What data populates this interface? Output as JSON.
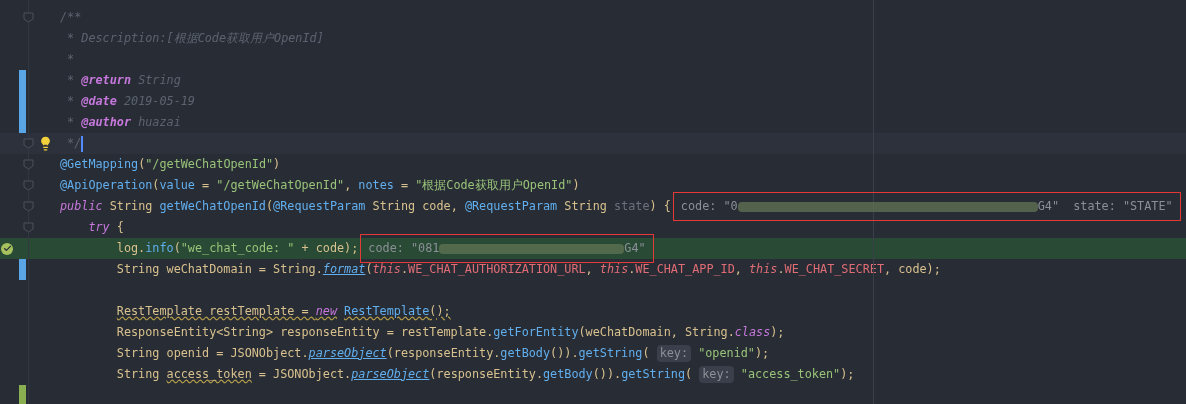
{
  "editor": {
    "lines": [
      {
        "fold": true,
        "modified": false,
        "added": false,
        "current": false,
        "execution": false,
        "tokens": [
          {
            "kind": "comment",
            "text": "/**"
          }
        ]
      },
      {
        "fold": false,
        "modified": false,
        "added": false,
        "current": false,
        "execution": false,
        "tokens": [
          {
            "kind": "comment",
            "text": " * Description:[根据Code获取用户OpenId]"
          }
        ]
      },
      {
        "fold": false,
        "modified": false,
        "added": false,
        "current": false,
        "execution": false,
        "tokens": [
          {
            "kind": "comment",
            "text": " *"
          }
        ]
      },
      {
        "fold": false,
        "modified": true,
        "added": false,
        "current": false,
        "execution": false,
        "tokens": [
          {
            "kind": "comment",
            "text": " * "
          },
          {
            "kind": "doctag",
            "text": "@return"
          },
          {
            "kind": "comment",
            "text": " String"
          }
        ]
      },
      {
        "fold": false,
        "modified": true,
        "added": false,
        "current": false,
        "execution": false,
        "tokens": [
          {
            "kind": "comment",
            "text": " * "
          },
          {
            "kind": "doctag",
            "text": "@date"
          },
          {
            "kind": "comment",
            "text": " 2019-05-19"
          }
        ]
      },
      {
        "fold": false,
        "modified": true,
        "added": false,
        "current": false,
        "execution": false,
        "tokens": [
          {
            "kind": "comment",
            "text": " * "
          },
          {
            "kind": "doctag",
            "text": "@author"
          },
          {
            "kind": "comment",
            "text": " huazai"
          }
        ]
      },
      {
        "fold": true,
        "modified": false,
        "added": false,
        "current": true,
        "execution": false,
        "tokens": [
          {
            "kind": "comment",
            "text": " */"
          }
        ]
      },
      {
        "fold": true,
        "modified": false,
        "added": false,
        "current": false,
        "execution": false,
        "tokens": [
          {
            "kind": "annotation",
            "text": "@GetMapping"
          },
          {
            "kind": "plain",
            "text": "("
          },
          {
            "kind": "string",
            "text": "\"/getWeChatOpenId\""
          },
          {
            "kind": "plain",
            "text": ")"
          }
        ]
      },
      {
        "fold": true,
        "modified": false,
        "added": false,
        "current": false,
        "execution": false,
        "tokens": [
          {
            "kind": "annotation",
            "text": "@ApiOperation"
          },
          {
            "kind": "plain",
            "text": "("
          },
          {
            "kind": "annotation",
            "text": "value"
          },
          {
            "kind": "plain",
            "text": " = "
          },
          {
            "kind": "string",
            "text": "\"/getWeChatOpenId\""
          },
          {
            "kind": "plain",
            "text": ", "
          },
          {
            "kind": "annotation",
            "text": "notes"
          },
          {
            "kind": "plain",
            "text": " = "
          },
          {
            "kind": "string",
            "text": "\"根据Code获取用户OpenId\""
          },
          {
            "kind": "plain",
            "text": ")"
          }
        ]
      },
      {
        "fold": true,
        "modified": false,
        "added": false,
        "current": false,
        "execution": false,
        "tokens": [
          {
            "kind": "keyword",
            "text": "public"
          },
          {
            "kind": "plain",
            "text": " String "
          },
          {
            "kind": "method",
            "text": "getWeChatOpenId"
          },
          {
            "kind": "plain",
            "text": "("
          },
          {
            "kind": "annotation",
            "text": "@RequestParam"
          },
          {
            "kind": "plain",
            "text": " String code, "
          },
          {
            "kind": "annotation",
            "text": "@RequestParam"
          },
          {
            "kind": "plain",
            "text": " String "
          },
          {
            "kind": "unused",
            "text": "state"
          },
          {
            "kind": "plain",
            "text": ") {"
          }
        ],
        "hint": {
          "boxed": true,
          "parts": [
            {
              "kind": "hint",
              "text": "code: \"0"
            },
            {
              "kind": "redacted"
            },
            {
              "kind": "hint",
              "text": "G4\"  state: \"STATE\""
            }
          ]
        }
      },
      {
        "fold": true,
        "modified": false,
        "added": false,
        "current": false,
        "execution": false,
        "tokens": [
          {
            "kind": "keyword",
            "text": "    try"
          },
          {
            "kind": "plain",
            "text": " {"
          }
        ]
      },
      {
        "fold": false,
        "modified": false,
        "added": false,
        "current": false,
        "execution": true,
        "tokens": [
          {
            "kind": "plain",
            "text": "        log."
          },
          {
            "kind": "method",
            "text": "info"
          },
          {
            "kind": "plain",
            "text": "("
          },
          {
            "kind": "string",
            "text": "\"we_chat_code: \""
          },
          {
            "kind": "plain",
            "text": " + code);"
          }
        ],
        "hint": {
          "boxed": true,
          "parts": [
            {
              "kind": "hint",
              "text": "code: \"081"
            },
            {
              "kind": "redacted"
            },
            {
              "kind": "hint",
              "text": "G4\""
            }
          ]
        }
      },
      {
        "fold": false,
        "modified": true,
        "added": false,
        "current": false,
        "execution": false,
        "tokens": [
          {
            "kind": "plain",
            "text": "        String weChatDomain = String."
          },
          {
            "kind": "static",
            "text": "format"
          },
          {
            "kind": "plain",
            "text": "("
          },
          {
            "kind": "this",
            "text": "this"
          },
          {
            "kind": "plain",
            "text": "."
          },
          {
            "kind": "constant",
            "text": "WE_CHAT_AUTHORIZATION_URL"
          },
          {
            "kind": "plain",
            "text": ", "
          },
          {
            "kind": "this",
            "text": "this"
          },
          {
            "kind": "plain",
            "text": "."
          },
          {
            "kind": "constant",
            "text": "WE_CHAT_APP_ID"
          },
          {
            "kind": "plain",
            "text": ", "
          },
          {
            "kind": "this",
            "text": "this"
          },
          {
            "kind": "plain",
            "text": "."
          },
          {
            "kind": "constant",
            "text": "WE_CHAT_SECRET"
          },
          {
            "kind": "plain",
            "text": ", code);"
          }
        ]
      },
      {
        "fold": false,
        "modified": false,
        "added": false,
        "current": false,
        "execution": false
      },
      {
        "fold": false,
        "modified": false,
        "added": false,
        "current": false,
        "execution": false,
        "tokens": [
          {
            "kind": "warning",
            "text": "        RestTemplate restTemplate = "
          },
          {
            "kind": "keyword_warning",
            "text": "new"
          },
          {
            "kind": "method_warning",
            "text": " RestTemplate"
          },
          {
            "kind": "warning",
            "text": "();"
          }
        ]
      },
      {
        "fold": false,
        "modified": false,
        "added": false,
        "current": false,
        "execution": false,
        "tokens": [
          {
            "kind": "plain",
            "text": "        ResponseEntity<String> responseEntity = restTemplate."
          },
          {
            "kind": "method",
            "text": "getForEntity"
          },
          {
            "kind": "plain",
            "text": "(weChatDomain, String."
          },
          {
            "kind": "keyword",
            "text": "class"
          },
          {
            "kind": "plain",
            "text": ");"
          }
        ]
      },
      {
        "fold": false,
        "modified": false,
        "added": false,
        "current": false,
        "execution": false,
        "tokens": [
          {
            "kind": "plain",
            "text": "        String openid = JSONObject."
          },
          {
            "kind": "static",
            "text": "parseObject"
          },
          {
            "kind": "plain",
            "text": "(responseEntity."
          },
          {
            "kind": "method",
            "text": "getBody"
          },
          {
            "kind": "plain",
            "text": "())."
          },
          {
            "kind": "method",
            "text": "getString"
          },
          {
            "kind": "plain",
            "text": "( "
          },
          {
            "kind": "param",
            "text": "key:"
          },
          {
            "kind": "string",
            "text": " \"openid\""
          },
          {
            "kind": "plain",
            "text": ");"
          }
        ]
      },
      {
        "fold": false,
        "modified": false,
        "added": false,
        "current": false,
        "execution": false,
        "tokens": [
          {
            "kind": "plain",
            "text": "        String "
          },
          {
            "kind": "warning",
            "text": "access_token"
          },
          {
            "kind": "plain",
            "text": " = JSONObject."
          },
          {
            "kind": "static",
            "text": "parseObject"
          },
          {
            "kind": "plain",
            "text": "(responseEntity."
          },
          {
            "kind": "method",
            "text": "getBody"
          },
          {
            "kind": "plain",
            "text": "())."
          },
          {
            "kind": "method",
            "text": "getString"
          },
          {
            "kind": "plain",
            "text": "( "
          },
          {
            "kind": "param",
            "text": "key:"
          },
          {
            "kind": "string",
            "text": " \"access_token\""
          },
          {
            "kind": "plain",
            "text": ");"
          }
        ]
      },
      {
        "fold": false,
        "modified": false,
        "added": true,
        "current": false,
        "execution": false
      }
    ]
  }
}
